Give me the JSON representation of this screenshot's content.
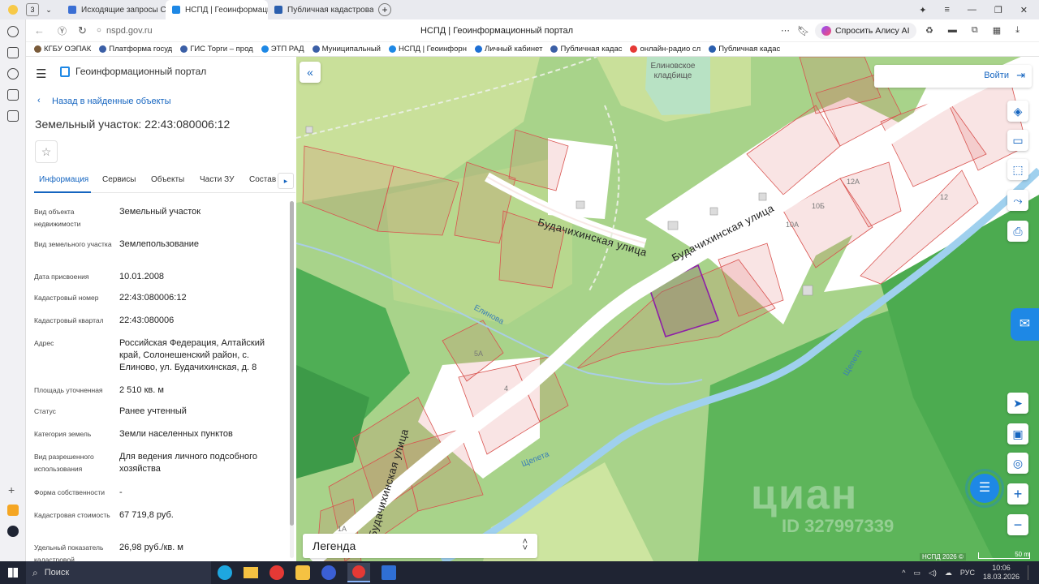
{
  "browser": {
    "tab_counter": "3",
    "tabs": [
      {
        "label": "Исходящие запросы СМЭ"
      },
      {
        "label": "НСПД | Геоинформацио"
      },
      {
        "label": "Публичная кадастровая к"
      }
    ],
    "address": "nspd.gov.ru",
    "page_title": "НСПД | Геоинформационный портал",
    "alice_label": "Спросить Алису AI",
    "bookmarks": [
      "КГБУ ОЭПАК",
      "Платформа госуд",
      "ГИС Торги – прод",
      "ЭТП РАД",
      "Муниципальный",
      "НСПД | Геоинфорн",
      "Личный кабинет",
      "Публичная кадас",
      "онлайн-радио сл",
      "Публичная кадас"
    ]
  },
  "panel": {
    "portal_title": "Геоинформационный портал",
    "back_link": "Назад в найденные объекты",
    "object_title": "Земельный участок: 22:43:080006:12",
    "tabs": [
      "Информация",
      "Сервисы",
      "Объекты",
      "Части ЗУ",
      "Состав"
    ],
    "fields": [
      {
        "label": "Вид объекта недвижимости",
        "value": "Земельный участок"
      },
      {
        "label": "Вид земельного участка",
        "value": "Землепользование"
      },
      {
        "label": "Дата присвоения",
        "value": "10.01.2008"
      },
      {
        "label": "Кадастровый номер",
        "value": "22:43:080006:12"
      },
      {
        "label": "Кадастровый квартал",
        "value": "22:43:080006"
      },
      {
        "label": "Адрес",
        "value": "Российская Федерация, Алтайский край, Солонешенский район, с. Елиново, ул. Будачихинская, д. 8"
      },
      {
        "label": "Площадь уточненная",
        "value": "2 510 кв. м"
      },
      {
        "label": "Статус",
        "value": "Ранее учтенный"
      },
      {
        "label": "Категория земель",
        "value": "Земли населенных пунктов"
      },
      {
        "label": "Вид разрешенного использования",
        "value": "Для ведения личного подсобного хозяйства"
      },
      {
        "label": "Форма собственности",
        "value": "-"
      },
      {
        "label": "Кадастровая стоимость",
        "value": "67 719,8 руб."
      },
      {
        "label": "Удельный показатель кадастровой",
        "value": "26,98 руб./кв. м"
      }
    ]
  },
  "map": {
    "login_label": "Войти",
    "legend_label": "Легенда",
    "cemetery_label": "Елиновское кладбище",
    "street_labels": [
      "Будачихинская улица",
      "Будачихинская улица",
      "Будачихинская улица"
    ],
    "river_labels": [
      "Елинова",
      "Щепета",
      "Щепета"
    ],
    "house_numbers": [
      "12А",
      "10Б",
      "10А",
      "12",
      "5А",
      "4",
      "1А"
    ],
    "watermark": "циан",
    "watermark_id": "ID 327997339",
    "copyright": "НСПД 2026 ©",
    "scale": "50 m",
    "zoom_in": "+",
    "zoom_out": "−"
  },
  "taskbar": {
    "search_label": "Поиск",
    "lang": "РУС",
    "time": "10:06",
    "date": "18.03.2026"
  },
  "colors": {
    "accent": "#1565c0",
    "map_green": "#a8d38a",
    "forest": "#5db55a",
    "parcel_fill": "#f4d6d3",
    "selected": "#8e1ea8"
  }
}
